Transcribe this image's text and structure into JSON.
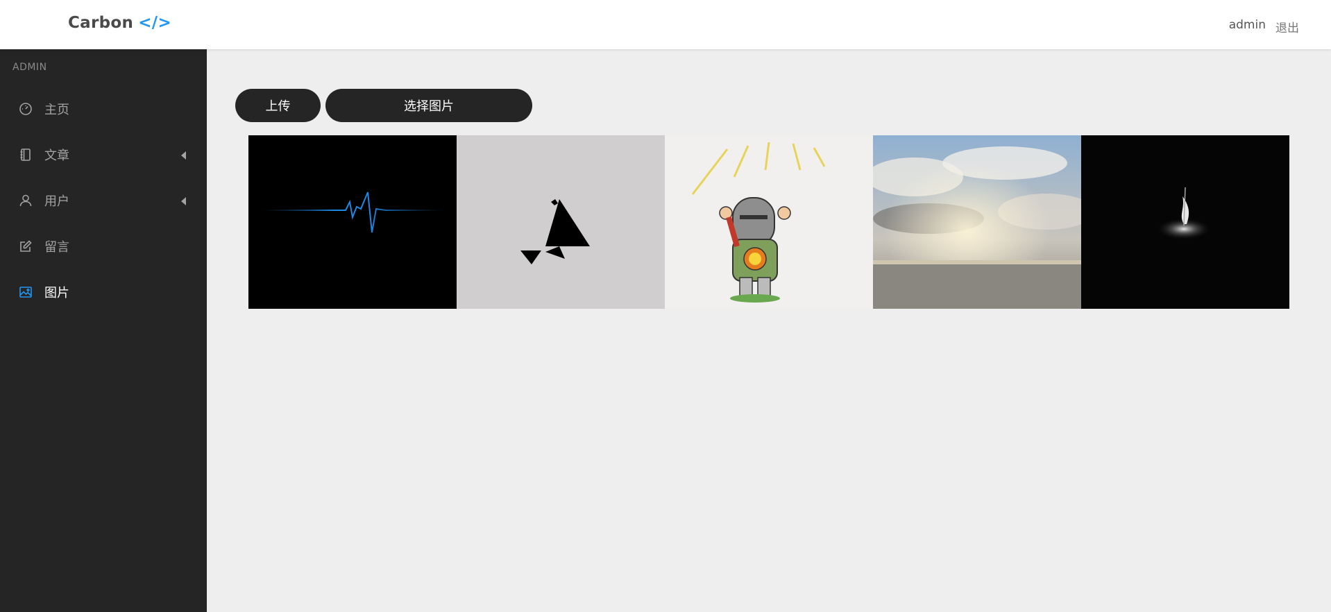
{
  "app": {
    "logo_text": "Carbon",
    "logo_code": "</>",
    "accent_color": "#2196f3"
  },
  "header": {
    "username": "admin",
    "logout_label": "退出"
  },
  "sidebar": {
    "section_title": "ADMIN",
    "items": [
      {
        "label": "主页",
        "icon": "dashboard-icon",
        "has_caret": false,
        "active": false
      },
      {
        "label": "文章",
        "icon": "notebook-icon",
        "has_caret": true,
        "active": false
      },
      {
        "label": "用户",
        "icon": "user-icon",
        "has_caret": true,
        "active": false
      },
      {
        "label": "留言",
        "icon": "edit-icon",
        "has_caret": false,
        "active": false
      },
      {
        "label": "图片",
        "icon": "image-icon",
        "has_caret": false,
        "active": true
      }
    ]
  },
  "toolbar": {
    "upload_label": "上传",
    "choose_label": "选择图片"
  },
  "gallery": {
    "images": [
      {
        "name": "heartbeat-line-image"
      },
      {
        "name": "triangle-silhouette-image"
      },
      {
        "name": "cartoon-knight-image"
      },
      {
        "name": "clouds-sea-image"
      },
      {
        "name": "bonfire-image"
      }
    ]
  }
}
